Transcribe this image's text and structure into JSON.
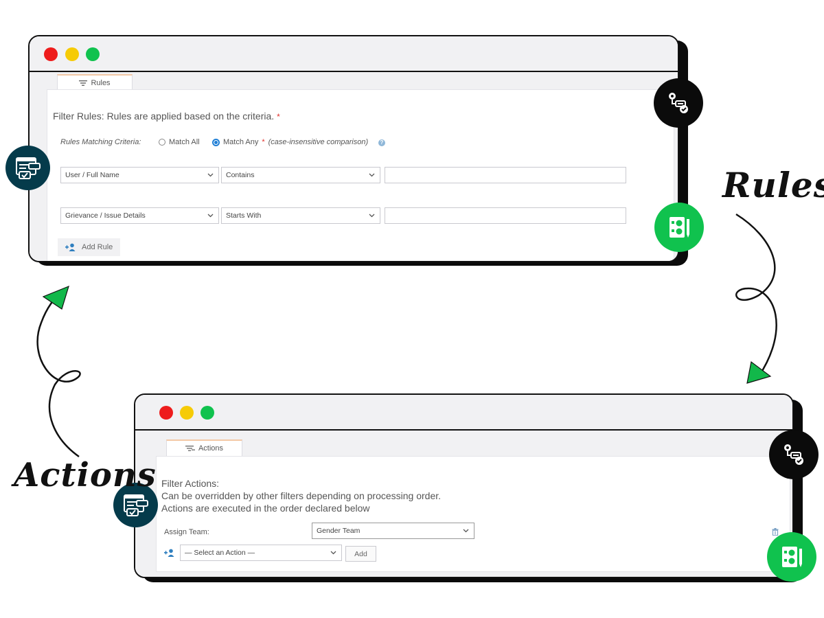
{
  "rules_window": {
    "tab_label": "Rules",
    "heading": "Filter Rules: Rules are applied based on the criteria.",
    "required_mark": "*",
    "criteria_label": "Rules Matching Criteria:",
    "match_all_label": "Match All",
    "match_any_label": "Match Any",
    "match_any_note": "(case-insensitive comparison)",
    "selected_criteria": "Match Any",
    "rules": [
      {
        "field": "User / Full Name",
        "operator": "Contains",
        "value": ""
      },
      {
        "field": "Grievance / Issue Details",
        "operator": "Starts With",
        "value": ""
      }
    ],
    "add_rule_label": "Add Rule"
  },
  "actions_window": {
    "tab_label": "Actions",
    "heading_lines": [
      "Filter Actions:",
      "Can be overridden by other filters depending on processing order.",
      "Actions are executed in the order declared below"
    ],
    "assign_team_label": "Assign Team:",
    "assign_team_value": "Gender Team",
    "select_action_placeholder": "— Select an Action —",
    "add_button_label": "Add"
  },
  "annotations": {
    "rules_label": "Rules",
    "actions_label": "Actions"
  },
  "colors": {
    "dark_teal": "#053b4b",
    "bright_green": "#10c24e",
    "black": "#0b0b0b",
    "arrow_green": "#12b84a",
    "radio_blue": "#1f7fd6",
    "required_red": "#e0302b"
  }
}
